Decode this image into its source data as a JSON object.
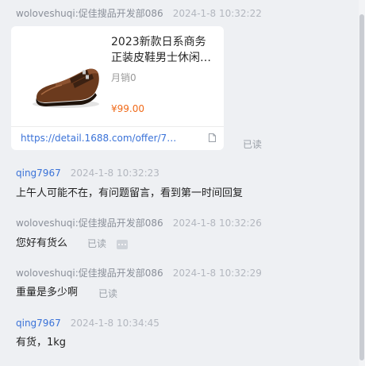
{
  "messages": [
    {
      "sender": "woloveshuqi:促佳搜品开发部086",
      "time": "2024-1-8 10:32:22",
      "type": "product-card",
      "card": {
        "title_line1": "2023新款日系商务",
        "title_line2": "正装皮鞋男士休闲…",
        "sales": "月销0",
        "price": "¥99.00",
        "link": "https://detail.1688.com/offer/75…",
        "image": "brown-leather-monk-strap-shoe"
      },
      "status": "已读"
    },
    {
      "sender": "qing7967",
      "time": "2024-1-8 10:32:23",
      "text": "上午人可能不在，有问题留言，看到第一时间回复"
    },
    {
      "sender": "woloveshuqi:促佳搜品开发部086",
      "time": "2024-1-8 10:32:26",
      "text": "您好有货么",
      "status": "已读"
    },
    {
      "sender": "woloveshuqi:促佳搜品开发部086",
      "time": "2024-1-8 10:32:29",
      "text": "重量是多少啊",
      "status": "已读"
    },
    {
      "sender": "qing7967",
      "time": "2024-1-8 10:34:45",
      "text": "有货，1kg"
    }
  ],
  "icons": {
    "card_link": "document-icon",
    "message_action": "more-dots-icon"
  },
  "colors": {
    "background": "#eef0f3",
    "self_sender": "#3a72d8",
    "other_sender": "#8a8f99",
    "price": "#f06a19",
    "link": "#3a72d8"
  }
}
